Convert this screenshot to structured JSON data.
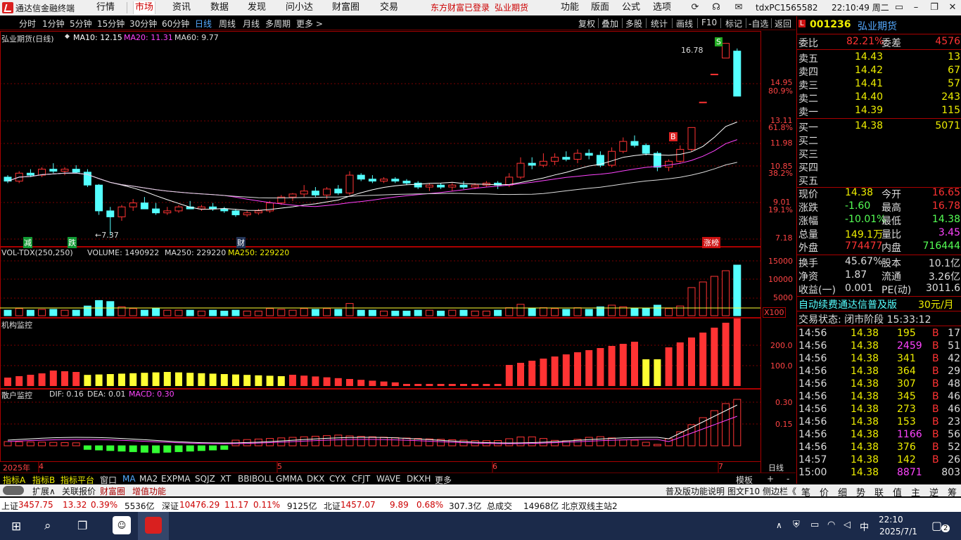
{
  "menubar": {
    "title": "通达信金融终端",
    "items": [
      "行情",
      "市场",
      "资讯",
      "数据",
      "发现",
      "问小达",
      "财富圈",
      "交易"
    ],
    "active": "市场",
    "login": "东方财富已登录",
    "stock": "弘业期货",
    "right_items": [
      "功能",
      "版面",
      "公式",
      "选项"
    ],
    "account": "tdxPC1565582",
    "time": "22:10:49 周二"
  },
  "periods": [
    "分时",
    "1分钟",
    "5分钟",
    "15分钟",
    "30分钟",
    "60分钟",
    "日线",
    "周线",
    "月线",
    "多周期",
    "更多 >"
  ],
  "active_period": "日线",
  "toolbar_right": [
    "复权",
    "叠加",
    "多股",
    "统计",
    "画线",
    "F10",
    "标记",
    "-自选",
    "返回"
  ],
  "legend": {
    "name": "弘业期货(日线)",
    "ma10": "MA10: 12.15",
    "ma20": "MA20: 11.31",
    "ma60": "MA60: 9.77",
    "vol_name": "VOL-TDX(250,250)",
    "volume": "VOLUME: 1490922",
    "vma1": "MA250: 229220",
    "vma2": "MA250: 229220",
    "jg": "机构监控",
    "sh_name": "散户监控",
    "dif": "DIF: 0.16",
    "dea": "DEA: 0.01",
    "macd": "MACD: 0.30"
  },
  "price_axis": [
    {
      "v": "14.95",
      "p": "80.9%"
    },
    {
      "v": "13.11",
      "p": "61.8%"
    },
    {
      "v": "11.98",
      "p": ""
    },
    {
      "v": "10.85",
      "p": "38.2%"
    },
    {
      "v": "9.01",
      "p": "19.1%"
    },
    {
      "v": "7.18",
      "p": ""
    }
  ],
  "vol_axis": [
    "15000",
    "10000",
    "5000",
    "X100"
  ],
  "jg_axis": [
    "200.0",
    "100.0"
  ],
  "sh_axis": [
    "0.30",
    "0.15"
  ],
  "date_axis": [
    "2025年",
    "4",
    "5",
    "6",
    "7",
    "日线"
  ],
  "annotations": {
    "high": "16.78",
    "low": "←7.37",
    "s": "S",
    "b": "B",
    "jian": "减",
    "die": "跌",
    "cai": "财",
    "zhangbang": "涨榜"
  },
  "chart_data": {
    "type": "candlestick",
    "title": "弘业期货(日线)",
    "ylim": [
      7.18,
      16.78
    ],
    "candles": [
      [
        10.3,
        10.4,
        10.0,
        10.1
      ],
      [
        10.1,
        10.6,
        10.0,
        10.5
      ],
      [
        10.5,
        10.7,
        10.3,
        10.4
      ],
      [
        10.4,
        10.8,
        10.3,
        10.7
      ],
      [
        10.7,
        11.0,
        10.5,
        10.6
      ],
      [
        10.6,
        10.8,
        10.4,
        10.7
      ],
      [
        10.7,
        10.9,
        10.5,
        10.55
      ],
      [
        10.55,
        10.7,
        9.8,
        9.9
      ],
      [
        9.9,
        9.95,
        8.4,
        8.6
      ],
      [
        8.6,
        8.8,
        7.37,
        8.3
      ],
      [
        8.3,
        8.9,
        8.1,
        8.8
      ],
      [
        8.8,
        9.2,
        8.6,
        9.0
      ],
      [
        9.0,
        9.3,
        8.9,
        8.7
      ],
      [
        8.7,
        9.0,
        8.4,
        8.5
      ],
      [
        8.5,
        8.8,
        8.4,
        8.6
      ],
      [
        8.6,
        8.9,
        8.5,
        8.8
      ],
      [
        8.8,
        9.1,
        8.7,
        8.7
      ],
      [
        8.7,
        8.9,
        8.6,
        8.8
      ],
      [
        8.8,
        9.0,
        8.6,
        8.7
      ],
      [
        8.7,
        8.8,
        8.5,
        8.6
      ],
      [
        8.6,
        8.7,
        8.3,
        8.4
      ],
      [
        8.4,
        8.6,
        8.3,
        8.5
      ],
      [
        8.5,
        8.7,
        8.4,
        8.6
      ],
      [
        8.6,
        9.1,
        8.5,
        9.0
      ],
      [
        9.0,
        9.4,
        8.9,
        9.3
      ],
      [
        9.3,
        9.5,
        9.1,
        9.45
      ],
      [
        9.45,
        9.9,
        9.3,
        9.6
      ],
      [
        9.6,
        9.8,
        9.3,
        9.4
      ],
      [
        9.4,
        9.8,
        9.2,
        9.7
      ],
      [
        9.7,
        9.9,
        9.4,
        9.5
      ],
      [
        9.5,
        10.6,
        9.4,
        10.4
      ],
      [
        10.4,
        10.5,
        10.1,
        10.2
      ],
      [
        10.2,
        10.4,
        10.0,
        10.1
      ],
      [
        10.1,
        10.3,
        10.0,
        10.2
      ],
      [
        10.2,
        10.3,
        10.0,
        10.1
      ],
      [
        10.1,
        10.2,
        9.9,
        10.0
      ],
      [
        10.0,
        10.1,
        9.7,
        9.8
      ],
      [
        9.8,
        10.0,
        9.6,
        9.9
      ],
      [
        9.9,
        10.0,
        9.7,
        9.8
      ],
      [
        9.8,
        10.0,
        9.6,
        9.9
      ],
      [
        9.9,
        10.1,
        9.7,
        9.8
      ],
      [
        9.8,
        10.0,
        9.7,
        9.9
      ],
      [
        9.9,
        10.1,
        9.8,
        10.0
      ],
      [
        10.0,
        10.1,
        9.7,
        9.9
      ],
      [
        9.9,
        10.5,
        9.8,
        10.3
      ],
      [
        10.3,
        11.3,
        10.2,
        11.0
      ],
      [
        11.0,
        11.3,
        10.7,
        10.9
      ],
      [
        10.9,
        11.5,
        10.8,
        11.1
      ],
      [
        11.1,
        11.5,
        10.9,
        11.3
      ],
      [
        11.3,
        11.6,
        11.1,
        11.2
      ],
      [
        11.2,
        11.7,
        11.0,
        11.5
      ],
      [
        11.5,
        11.7,
        11.2,
        11.4
      ],
      [
        11.4,
        11.6,
        10.8,
        10.9
      ],
      [
        10.9,
        11.8,
        10.8,
        11.6
      ],
      [
        11.6,
        12.3,
        11.5,
        12.1
      ],
      [
        12.1,
        12.4,
        11.8,
        11.9
      ],
      [
        11.9,
        12.0,
        11.4,
        11.5
      ],
      [
        11.5,
        11.6,
        10.6,
        10.8
      ],
      [
        10.8,
        11.2,
        10.6,
        11.1
      ],
      [
        11.1,
        11.9,
        11.0,
        11.7
      ],
      [
        11.7,
        12.8,
        11.6,
        12.8
      ],
      [
        14.08,
        14.08,
        14.08,
        14.08
      ],
      [
        15.49,
        15.49,
        15.49,
        15.49
      ],
      [
        16.3,
        17.04,
        16.3,
        17.04
      ],
      [
        16.65,
        16.78,
        14.38,
        14.38
      ]
    ]
  },
  "right_panel": {
    "code": "001236",
    "name": "弘业期货",
    "weibi_label": "委比",
    "weibi": "82.21%",
    "weicha_label": "委差",
    "weicha": "4576",
    "asks": [
      [
        "卖五",
        "14.43",
        "13"
      ],
      [
        "卖四",
        "14.42",
        "67"
      ],
      [
        "卖三",
        "14.41",
        "57"
      ],
      [
        "卖二",
        "14.40",
        "243"
      ],
      [
        "卖一",
        "14.39",
        "115"
      ]
    ],
    "bids": [
      [
        "买一",
        "14.38",
        "5071"
      ],
      [
        "买二",
        "",
        ""
      ],
      [
        "买三",
        "",
        ""
      ],
      [
        "买四",
        "",
        ""
      ],
      [
        "买五",
        "",
        ""
      ]
    ],
    "stats": [
      [
        "现价",
        "14.38",
        "今开",
        "16.65"
      ],
      [
        "涨跌",
        "-1.60",
        "最高",
        "16.78"
      ],
      [
        "涨幅",
        "-10.01%",
        "最低",
        "14.38"
      ],
      [
        "总量",
        "149.1万",
        "量比",
        "3.45"
      ],
      [
        "外盘",
        "774477",
        "内盘",
        "716444"
      ]
    ],
    "stats2": [
      [
        "换手",
        "45.67%",
        "股本",
        "10.1亿"
      ],
      [
        "净资",
        "1.87",
        "流通",
        "3.26亿"
      ],
      [
        "收益(一)",
        "0.001",
        "PE(动)",
        "3011.6"
      ]
    ],
    "promo": "自动续费通达信普及版",
    "price_tag": "30元/月",
    "trade_status": "交易状态: 闭市阶段 15:33:12",
    "ticks": [
      [
        "14:56",
        "14.38",
        "195",
        "B",
        "17"
      ],
      [
        "14:56",
        "14.38",
        "2459",
        "B",
        "51"
      ],
      [
        "14:56",
        "14.38",
        "341",
        "B",
        "42"
      ],
      [
        "14:56",
        "14.38",
        "364",
        "B",
        "29"
      ],
      [
        "14:56",
        "14.38",
        "307",
        "B",
        "48"
      ],
      [
        "14:56",
        "14.38",
        "345",
        "B",
        "46"
      ],
      [
        "14:56",
        "14.38",
        "273",
        "B",
        "46"
      ],
      [
        "14:56",
        "14.38",
        "153",
        "B",
        "23"
      ],
      [
        "14:56",
        "14.38",
        "1166",
        "B",
        "56"
      ],
      [
        "14:56",
        "14.38",
        "376",
        "B",
        "52"
      ],
      [
        "14:57",
        "14.38",
        "142",
        "B",
        "26"
      ],
      [
        "15:00",
        "14.38",
        "8871",
        "",
        "803"
      ]
    ]
  },
  "tabs": [
    "指标A",
    "指标B",
    "指标平台",
    "窗口",
    "MA",
    "MA2",
    "EXPMA",
    "SQJZ",
    "XT",
    "BBIBOLL",
    "GMMA",
    "DKX",
    "CYX",
    "CFJT",
    "WAVE",
    "DKXH",
    "更多"
  ],
  "tabs_right": [
    "模板",
    "+",
    "-"
  ],
  "tabs2": [
    "扩展∧",
    "关联报价",
    "财富圈",
    "增值功能"
  ],
  "tabs2_right": [
    "普及版功能说明",
    "图文F10",
    "侧边栏《"
  ],
  "tabs2_panel": [
    "笔",
    "价",
    "细",
    "势",
    "联",
    "值",
    "主",
    "逆",
    "筹"
  ],
  "status": {
    "sh_label": "上证",
    "sh": "3457.75",
    "sh_chg": "13.32",
    "sh_pct": "0.39%",
    "sh_amt": "5536亿",
    "sz_label": "深证",
    "sz": "10476.29",
    "sz_chg": "11.17",
    "sz_pct": "0.11%",
    "sz_amt": "9125亿",
    "bz_label": "北证",
    "bz": "1457.07",
    "bz_chg": "9.89",
    "bz_pct": "0.68%",
    "bz_amt": "307.3亿",
    "total_label": "总成交",
    "total": "14968亿",
    "server": "北京双线主站2"
  },
  "taskbar": {
    "time": "22:10",
    "date": "2025/7/1",
    "ime": "中",
    "notif": "2"
  },
  "colors": {
    "up": "#ff3333",
    "down": "#54ffff",
    "ma10": "#ffffff",
    "ma20": "#ff44ff",
    "ma60": "#dddddd",
    "yellow": "#ffff33",
    "grid": "#7a0000"
  }
}
